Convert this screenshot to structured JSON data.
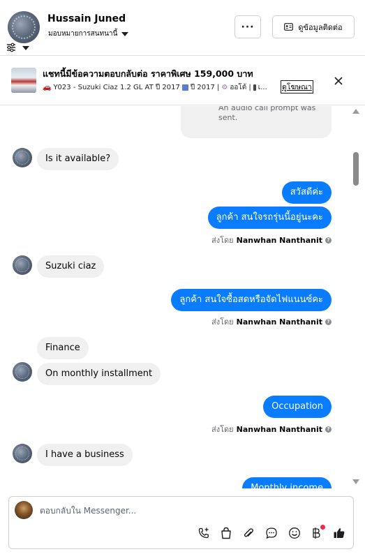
{
  "header": {
    "contact_name": "Hussain Juned",
    "assign_label": "มอบหมายการสนทนานี้",
    "more_label": "···",
    "contact_info_label": "ดูข้อมูลติดต่อ"
  },
  "ad": {
    "title": "แชทนี้มีข้อความตอบกลับต่อ ราคาพิเศษ 159,000 บาท",
    "subtitle_model": "Y023 - Suzuki Ciaz 1.2 GL AT ปี 2017",
    "subtitle_year": "ปี 2017 |",
    "subtitle_trans": "ออโต้ |",
    "subtitle_more": "เ...",
    "link_label": "ดูโฆษณา"
  },
  "messages": {
    "system_line1": "An audio call prompt was",
    "system_line2": "sent.",
    "m1": "Is it available?",
    "m2": "สวัสดีค่ะ",
    "m3": "ลูกค้า สนใจรถรุ่นนี้อยู่นะคะ",
    "sent_prefix": "ส่งโดย",
    "sender": "Nanwhan Nanthanit",
    "m4": "Suzuki ciaz",
    "m5": "ลูกค้า  สนใจซื้อสดหรือจัดไฟแนนซ์คะ",
    "m6": "Finance",
    "m7": "On monthly installment",
    "m8": "Occupation",
    "m9": "I have a business",
    "m10": "Monthly income"
  },
  "composer": {
    "placeholder": "ตอบกลับใน Messenger..."
  },
  "colors": {
    "outgoing_bubble": "#0a7cff",
    "incoming_bubble": "#f0f0f0",
    "notification_dot": "#f02849"
  }
}
